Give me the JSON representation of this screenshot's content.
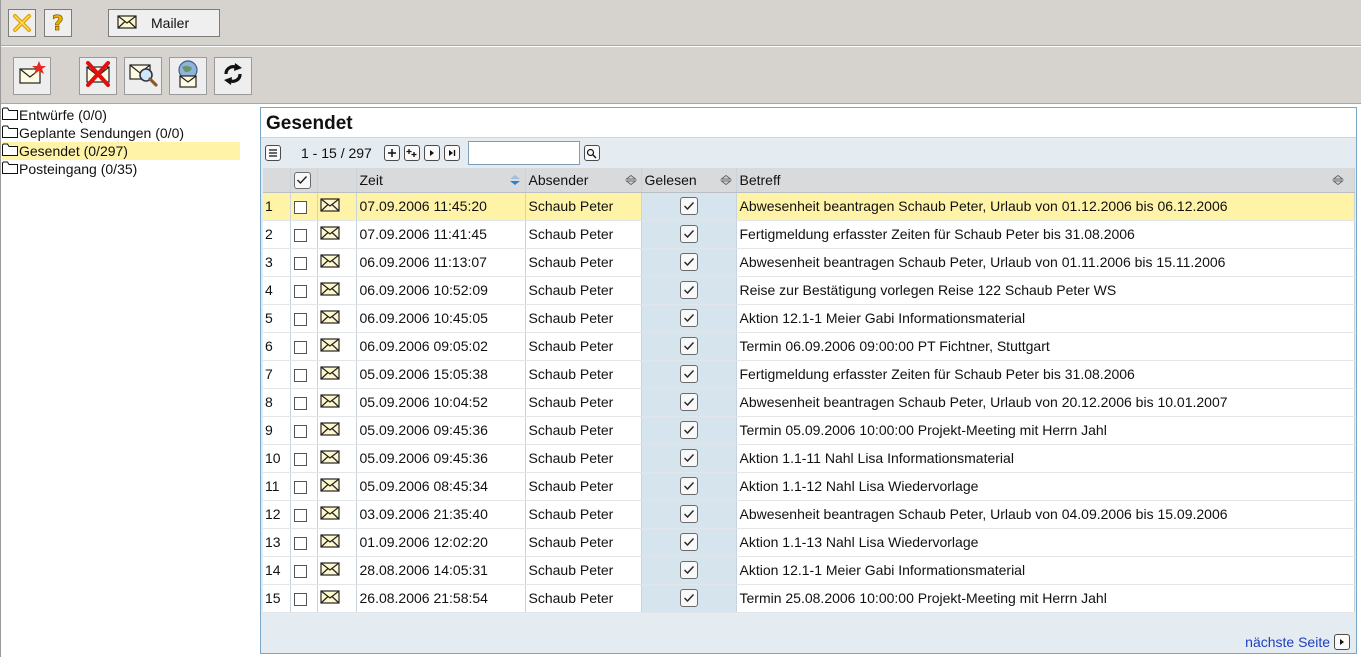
{
  "tabbar": {
    "mailer_label": "Mailer"
  },
  "sidebar": {
    "folders": [
      {
        "label": "Entwürfe (0/0)",
        "active": false
      },
      {
        "label": "Geplante Sendungen (0/0)",
        "active": false
      },
      {
        "label": "Gesendet (0/297)",
        "active": true
      },
      {
        "label": "Posteingang (0/35)",
        "active": false
      }
    ]
  },
  "panel": {
    "title": "Gesendet",
    "range": "1 - 15 / 297",
    "search_value": "",
    "next_page": "nächste Seite"
  },
  "table": {
    "headers": {
      "zeit": "Zeit",
      "absender": "Absender",
      "gelesen": "Gelesen",
      "betreff": "Betreff"
    },
    "rows": [
      {
        "n": "1",
        "zeit": "07.09.2006 11:45:20",
        "absender": "Schaub Peter",
        "betreff": "Abwesenheit beantragen Schaub Peter, Urlaub von 01.12.2006 bis 06.12.2006"
      },
      {
        "n": "2",
        "zeit": "07.09.2006 11:41:45",
        "absender": "Schaub Peter",
        "betreff": "Fertigmeldung erfasster Zeiten für Schaub Peter bis 31.08.2006"
      },
      {
        "n": "3",
        "zeit": "06.09.2006 11:13:07",
        "absender": "Schaub Peter",
        "betreff": "Abwesenheit beantragen Schaub Peter, Urlaub von 01.11.2006 bis 15.11.2006"
      },
      {
        "n": "4",
        "zeit": "06.09.2006 10:52:09",
        "absender": "Schaub Peter",
        "betreff": "Reise zur Bestätigung vorlegen Reise 122 Schaub Peter WS"
      },
      {
        "n": "5",
        "zeit": "06.09.2006 10:45:05",
        "absender": "Schaub Peter",
        "betreff": "Aktion 12.1-1 Meier Gabi Informationsmaterial"
      },
      {
        "n": "6",
        "zeit": "06.09.2006 09:05:02",
        "absender": "Schaub Peter",
        "betreff": "Termin 06.09.2006 09:00:00 PT Fichtner, Stuttgart"
      },
      {
        "n": "7",
        "zeit": "05.09.2006 15:05:38",
        "absender": "Schaub Peter",
        "betreff": "Fertigmeldung erfasster Zeiten für Schaub Peter bis 31.08.2006"
      },
      {
        "n": "8",
        "zeit": "05.09.2006 10:04:52",
        "absender": "Schaub Peter",
        "betreff": "Abwesenheit beantragen Schaub Peter, Urlaub von 20.12.2006 bis 10.01.2007"
      },
      {
        "n": "9",
        "zeit": "05.09.2006 09:45:36",
        "absender": "Schaub Peter",
        "betreff": "Termin 05.09.2006 10:00:00 Projekt-Meeting mit Herrn Jahl"
      },
      {
        "n": "10",
        "zeit": "05.09.2006 09:45:36",
        "absender": "Schaub Peter",
        "betreff": "Aktion 1.1-11 Nahl Lisa Informationsmaterial"
      },
      {
        "n": "11",
        "zeit": "05.09.2006 08:45:34",
        "absender": "Schaub Peter",
        "betreff": "Aktion 1.1-12 Nahl Lisa Wiedervorlage"
      },
      {
        "n": "12",
        "zeit": "03.09.2006 21:35:40",
        "absender": "Schaub Peter",
        "betreff": "Abwesenheit beantragen Schaub Peter, Urlaub von 04.09.2006 bis 15.09.2006"
      },
      {
        "n": "13",
        "zeit": "01.09.2006 12:02:20",
        "absender": "Schaub Peter",
        "betreff": "Aktion 1.1-13 Nahl Lisa Wiedervorlage"
      },
      {
        "n": "14",
        "zeit": "28.08.2006 14:05:31",
        "absender": "Schaub Peter",
        "betreff": "Aktion 12.1-1 Meier Gabi Informationsmaterial"
      },
      {
        "n": "15",
        "zeit": "26.08.2006 21:58:54",
        "absender": "Schaub Peter",
        "betreff": "Termin 25.08.2006 10:00:00 Projekt-Meeting mit Herrn Jahl"
      }
    ]
  },
  "colors": {
    "chrome": "#d6d3ce",
    "selected_row": "#fff3a8",
    "gelesen_column": "#d6e4ee",
    "panel_border": "#7aa7c7",
    "link": "#1d3fbf"
  }
}
